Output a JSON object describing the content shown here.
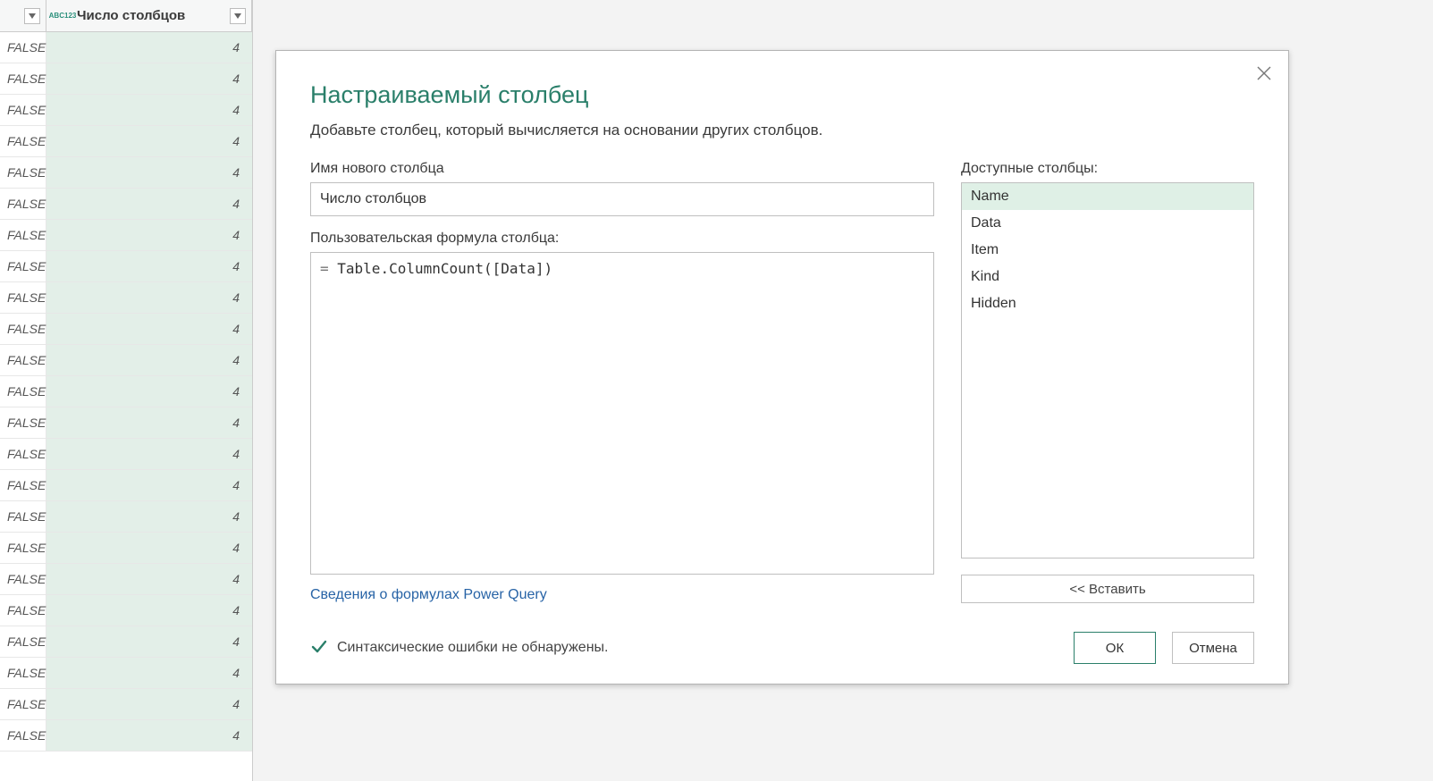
{
  "grid": {
    "column2_header": "Число столбцов",
    "type_badge_top": "ABC",
    "type_badge_bot": "123",
    "rows": [
      {
        "a": "FALSE",
        "b": "4"
      },
      {
        "a": "FALSE",
        "b": "4"
      },
      {
        "a": "FALSE",
        "b": "4"
      },
      {
        "a": "FALSE",
        "b": "4"
      },
      {
        "a": "FALSE",
        "b": "4"
      },
      {
        "a": "FALSE",
        "b": "4"
      },
      {
        "a": "FALSE",
        "b": "4"
      },
      {
        "a": "FALSE",
        "b": "4"
      },
      {
        "a": "FALSE",
        "b": "4"
      },
      {
        "a": "FALSE",
        "b": "4"
      },
      {
        "a": "FALSE",
        "b": "4"
      },
      {
        "a": "FALSE",
        "b": "4"
      },
      {
        "a": "FALSE",
        "b": "4"
      },
      {
        "a": "FALSE",
        "b": "4"
      },
      {
        "a": "FALSE",
        "b": "4"
      },
      {
        "a": "FALSE",
        "b": "4"
      },
      {
        "a": "FALSE",
        "b": "4"
      },
      {
        "a": "FALSE",
        "b": "4"
      },
      {
        "a": "FALSE",
        "b": "4"
      },
      {
        "a": "FALSE",
        "b": "4"
      },
      {
        "a": "FALSE",
        "b": "4"
      },
      {
        "a": "FALSE",
        "b": "4"
      },
      {
        "a": "FALSE",
        "b": "4"
      }
    ]
  },
  "dialog": {
    "title": "Настраиваемый столбец",
    "subtitle": "Добавьте столбец, который вычисляется на основании других столбцов.",
    "name_label": "Имя нового столбца",
    "name_value": "Число столбцов",
    "formula_label": "Пользовательская формула столбца:",
    "formula_prefix": "=",
    "formula_body": " Table.ColumnCount([Data])",
    "available_label": "Доступные столбцы:",
    "available_columns": [
      "Name",
      "Data",
      "Item",
      "Kind",
      "Hidden"
    ],
    "selected_column_index": 0,
    "insert_label": "<< Вставить",
    "info_link": "Сведения о формулах Power Query",
    "status_text": "Синтаксические ошибки не обнаружены.",
    "ok_label": "ОК",
    "cancel_label": "Отмена"
  }
}
